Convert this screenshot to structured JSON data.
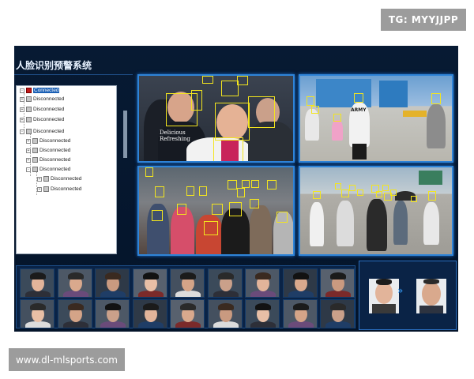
{
  "watermark_top": "TG: MYYJJPP",
  "watermark_bottom": "www.dl-mlsports.com",
  "app": {
    "title": "人脸识别预警系统"
  },
  "device_tree": {
    "items": [
      {
        "label": "Connected",
        "status": "connected",
        "level": 0,
        "selected": true
      },
      {
        "label": "Disconnected",
        "status": "disconnected",
        "level": 0
      },
      {
        "label": "Disconnected",
        "status": "disconnected",
        "level": 0
      },
      {
        "label": "Disconnected",
        "status": "disconnected",
        "level": 0
      },
      {
        "label": "Disconnected",
        "status": "disconnected",
        "level": 0
      },
      {
        "label": "Disconnected",
        "status": "disconnected",
        "level": 1
      },
      {
        "label": "Disconnected",
        "status": "disconnected",
        "level": 1
      },
      {
        "label": "Disconnected",
        "status": "disconnected",
        "level": 1
      },
      {
        "label": "Disconnected",
        "status": "disconnected",
        "level": 1
      },
      {
        "label": "Disconnected",
        "status": "disconnected",
        "level": 2
      },
      {
        "label": "Disconnected",
        "status": "disconnected",
        "level": 2
      }
    ]
  },
  "cameras": [
    {
      "id": "cam-1",
      "scene": "close-up faces",
      "shirt_text": "Delicious Refreshing",
      "detections": 8
    },
    {
      "id": "cam-2",
      "scene": "street crossing",
      "shirt_text": "ARMY",
      "detections": 5
    },
    {
      "id": "cam-3",
      "scene": "crowd",
      "detections": 16
    },
    {
      "id": "cam-4",
      "scene": "pedestrian street",
      "detections": 12
    }
  ],
  "colors": {
    "screen_bg": "#04142a",
    "panel_border": "#2f84d8",
    "detection_box": "#f3e51e",
    "tree_selected": "#1a5fb4",
    "status_connected": "#c11a1a"
  },
  "face_strip": {
    "rows": 2,
    "columns": 9
  },
  "alert": {
    "faces": 2
  }
}
